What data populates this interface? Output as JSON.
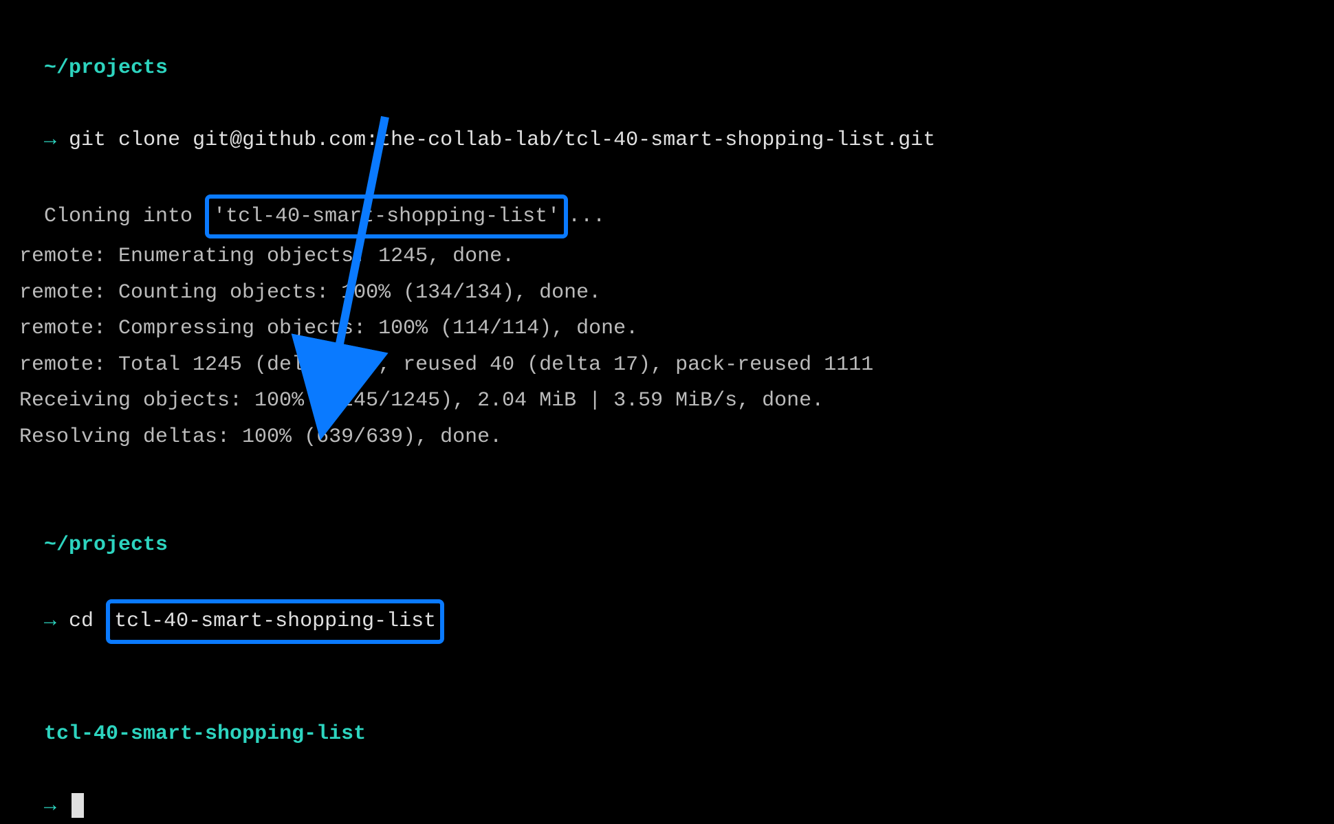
{
  "prompt1": {
    "path": "~/projects",
    "arrow": "→",
    "command": "git clone git@github.com:the-collab-lab/tcl-40-smart-shopping-list.git"
  },
  "output": {
    "cloning_prefix": "Cloning into ",
    "cloning_highlight": "'tcl-40-smart-shopping-list'",
    "cloning_suffix": "...",
    "line_enumerating": "remote: Enumerating objects: 1245, done.",
    "line_counting": "remote: Counting objects: 100% (134/134), done.",
    "line_compressing": "remote: Compressing objects: 100% (114/114), done.",
    "line_total": "remote: Total 1245 (delta 39), reused 40 (delta 17), pack-reused 1111",
    "line_receiving": "Receiving objects: 100% (1245/1245), 2.04 MiB | 3.59 MiB/s, done.",
    "line_resolving": "Resolving deltas: 100% (639/639), done."
  },
  "prompt2": {
    "path": "~/projects",
    "arrow": "→",
    "command_prefix": "cd ",
    "command_highlight": "tcl-40-smart-shopping-list"
  },
  "prompt3": {
    "path": "tcl-40-smart-shopping-list",
    "arrow": "→"
  }
}
